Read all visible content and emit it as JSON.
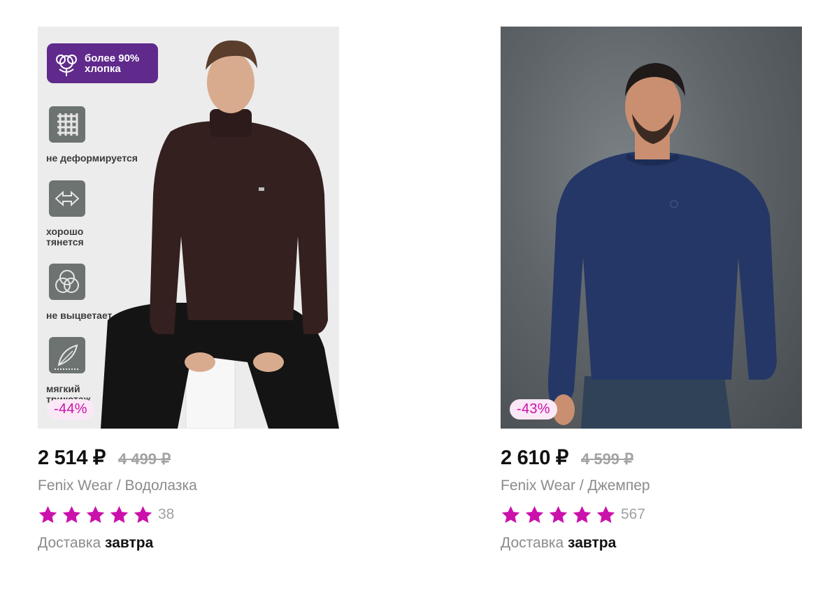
{
  "products": [
    {
      "discount": "-44%",
      "price": "2 514 ₽",
      "old_price": "4 499 ₽",
      "title": "Fenix Wear / Водолазка",
      "rating_count": "38",
      "delivery_label": "Доставка",
      "delivery_day": "завтра",
      "stars": 5,
      "badge": {
        "line1": "более 90%",
        "line2": "хлопка"
      },
      "features": [
        {
          "label1": "не деформируется",
          "label2": "",
          "icon": "weave-icon"
        },
        {
          "label1": "хорошо",
          "label2": "тянется",
          "icon": "stretch-arrows-icon"
        },
        {
          "label1": "не выцветает",
          "label2": "",
          "icon": "color-circles-icon"
        },
        {
          "label1": "мягкий",
          "label2": "трикотаж",
          "icon": "feather-icon"
        }
      ]
    },
    {
      "discount": "-43%",
      "price": "2 610 ₽",
      "old_price": "4 599 ₽",
      "title": "Fenix Wear / Джемпер",
      "rating_count": "567",
      "delivery_label": "Доставка",
      "delivery_day": "завтра",
      "stars": 5
    }
  ],
  "colors": {
    "accent": "#cb11ab",
    "discount_bg": "#fbe8f7",
    "badge_purple": "#5f2a8c"
  }
}
